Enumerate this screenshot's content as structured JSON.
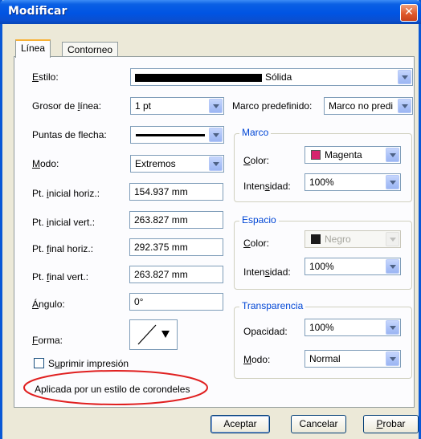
{
  "window": {
    "title": "Modificar"
  },
  "tabs": [
    "Línea",
    "Contorneo"
  ],
  "line": {
    "style_label": "Estilo:",
    "style_value": "Sólida",
    "weight_label": "Grosor de línea:",
    "weight_value": "1 pt",
    "preset_label": "Marco predefinido:",
    "preset_value": "Marco no predi",
    "arrowheads_label": "Puntas de flecha:",
    "mode_label": "Modo:",
    "mode_value": "Extremos",
    "start_h_label": "Pt. inicial horiz.:",
    "start_h_value": "154.937 mm",
    "start_v_label": "Pt. inicial vert.:",
    "start_v_value": "263.827 mm",
    "end_h_label": "Pt. final horiz.:",
    "end_h_value": "292.375 mm",
    "end_v_label": "Pt. final vert.:",
    "end_v_value": "263.827 mm",
    "angle_label": "Ángulo:",
    "angle_value": "0°",
    "shape_label": "Forma:",
    "suppress_label": "Suprimir impresión",
    "suppress_checked": false,
    "status_text": "Aplicada por un estilo de corondeles"
  },
  "frame_group": {
    "title": "Marco",
    "color_label": "Color:",
    "color_value": "Magenta",
    "color_hex": "#d6256d",
    "intensity_label": "Intensidad:",
    "intensity_value": "100%"
  },
  "gap_group": {
    "title": "Espacio",
    "color_label": "Color:",
    "color_value": "Negro",
    "color_hex": "#1a1a1a",
    "intensity_label": "Intensidad:",
    "intensity_value": "100%"
  },
  "transparency_group": {
    "title": "Transparencia",
    "opacity_label": "Opacidad:",
    "opacity_value": "100%",
    "mode_label": "Modo:",
    "mode_value": "Normal"
  },
  "buttons": {
    "accept": "Aceptar",
    "cancel": "Cancelar",
    "preview": "Probar"
  },
  "annotation": {
    "color": "#e02020"
  }
}
